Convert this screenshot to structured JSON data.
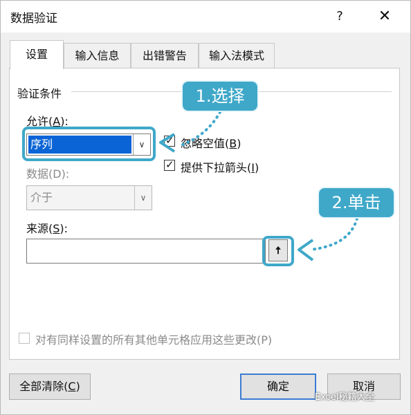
{
  "window": {
    "title": "数据验证",
    "help": "?",
    "close": "✕"
  },
  "tabs": [
    {
      "label": "设置",
      "active": true
    },
    {
      "label": "输入信息",
      "active": false
    },
    {
      "label": "出错警告",
      "active": false
    },
    {
      "label": "输入法模式",
      "active": false
    }
  ],
  "validation": {
    "group_label": "验证条件",
    "allow": {
      "label_prefix": "允许(",
      "label_key": "A",
      "label_suffix": "):",
      "value": "序列"
    },
    "ignore_blank": {
      "label_prefix": "忽略空值(",
      "label_key": "B",
      "label_suffix": ")",
      "checked": true
    },
    "dropdown": {
      "label_prefix": "提供下拉箭头(",
      "label_key": "I",
      "label_suffix": ")",
      "checked": true
    },
    "data": {
      "label": "数据(D):",
      "value": "介于"
    },
    "source": {
      "label_prefix": "来源(",
      "label_key": "S",
      "label_suffix": "):",
      "value": "",
      "button_icon": "upload-arrow-icon"
    },
    "apply_all": {
      "label": "对有同样设置的所有其他单元格应用这些更改(P)",
      "checked": false
    }
  },
  "footer": {
    "clear_all_prefix": "全部清除(",
    "clear_all_key": "C",
    "clear_all_suffix": ")",
    "ok": "确定",
    "cancel": "取消"
  },
  "annotations": {
    "step1": "1.选择",
    "step2": "2.单击",
    "accent": "#3fa8c9"
  },
  "watermark": "Excel秘籍大全",
  "icons": {
    "check": "✓",
    "chevron": "∨",
    "upload": "🠅"
  }
}
